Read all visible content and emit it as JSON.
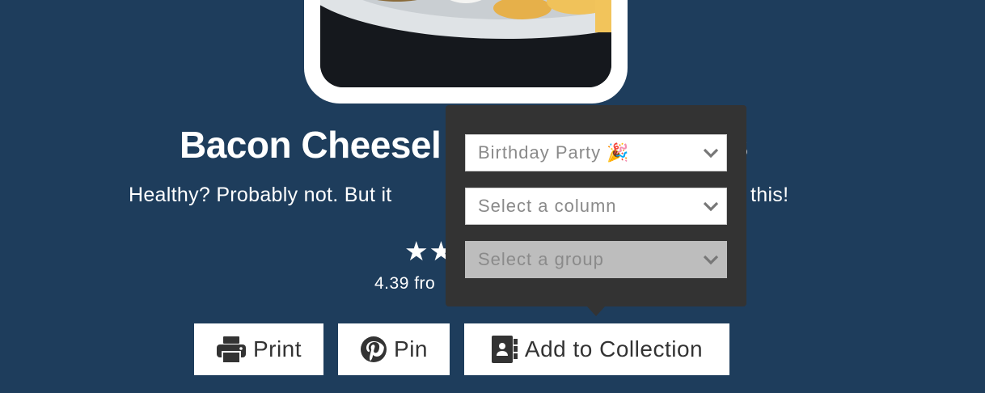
{
  "recipe": {
    "title": "Bacon Cheesel",
    "title_tail": "s",
    "subtitle": "Healthy? Probably not. But it",
    "subtitle_tail": "this!",
    "rating_stars": "★★",
    "rating_text": "4.39 fro"
  },
  "actions": {
    "print_label": "Print",
    "pin_label": "Pin",
    "collection_label": "Add to Collection"
  },
  "popover": {
    "board_value": "Birthday Party 🎉",
    "column_placeholder": "Select a column",
    "group_placeholder": "Select a group"
  },
  "icons": {
    "print": "printer-icon",
    "pin": "pinterest-icon",
    "collection": "contact-book-icon",
    "chevron": "chevron-down-icon"
  },
  "colors": {
    "background": "#1e3d5c",
    "popover": "#333333",
    "button": "#ffffff",
    "disabled_select": "#bdbdbd"
  }
}
